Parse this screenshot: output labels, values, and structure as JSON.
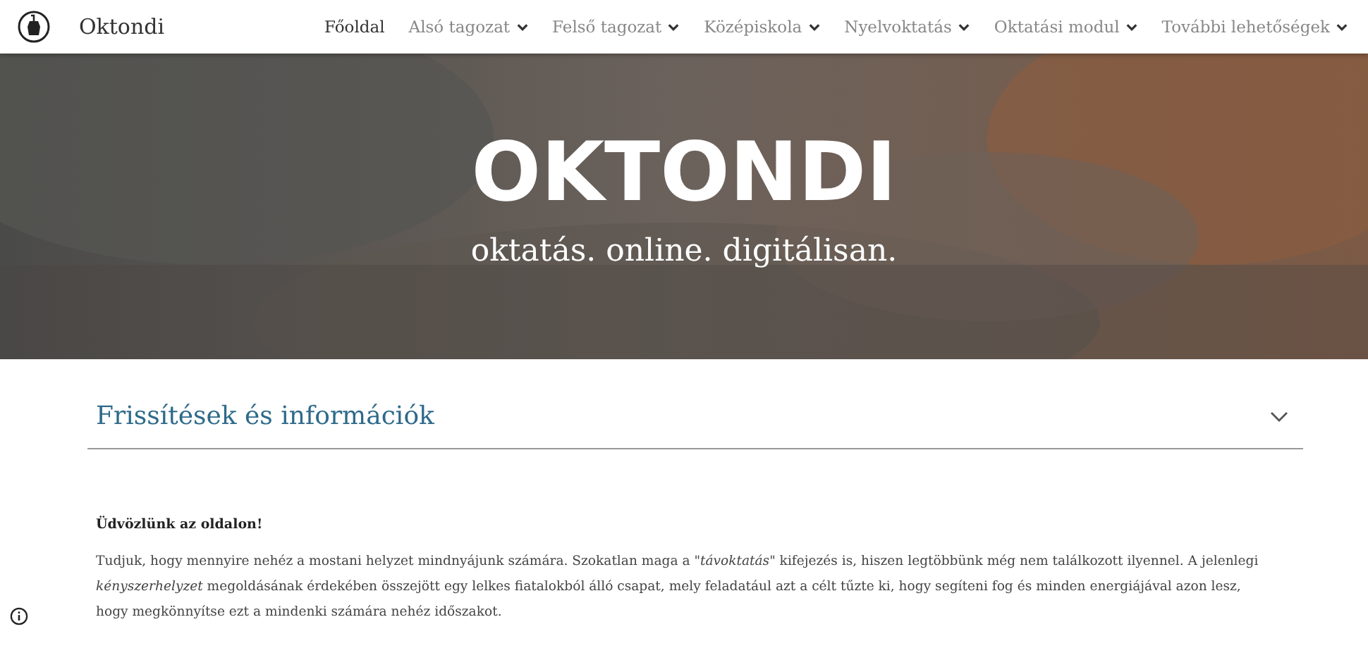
{
  "site": {
    "title": "Oktondi"
  },
  "nav": [
    {
      "label": "Főoldal",
      "selected": true,
      "dropdown": false
    },
    {
      "label": "Alsó tagozat",
      "selected": false,
      "dropdown": true
    },
    {
      "label": "Felső tagozat",
      "selected": false,
      "dropdown": true
    },
    {
      "label": "Középiskola",
      "selected": false,
      "dropdown": true
    },
    {
      "label": "Nyelvoktatás",
      "selected": false,
      "dropdown": true
    },
    {
      "label": "Oktatási modul",
      "selected": false,
      "dropdown": true
    },
    {
      "label": "További lehetőségek",
      "selected": false,
      "dropdown": true
    }
  ],
  "hero": {
    "kind": "picture",
    "title": "OKTONDI",
    "subtitle": "oktatás. online. digitálisan."
  },
  "section": {
    "title": "Frissítések és információk",
    "expanded": false
  },
  "content": {
    "heading": "Üdvözlünk az oldalon!",
    "paragraph": "Tudjuk, hogy mennyire nehéz a mostani helyzet mindnyájunk számára. Szokatlan maga a \"*távoktatás*\" kifejezés is, hiszen legtöbbünk még nem találkozott ilyennel. A jelenlegi *kényszerhelyzet* megoldásának érdekében összejött egy lelkes fiatalokból álló csapat, mely feladatául azt a célt tűzte ki, hogy segíteni fog és minden energiájával azon lesz, hogy megkönnyítse ezt a mindenki számára nehéz időszakot."
  }
}
